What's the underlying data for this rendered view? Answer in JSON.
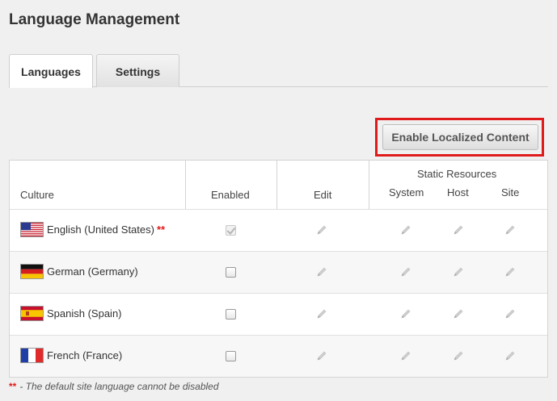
{
  "page": {
    "title": "Language Management"
  },
  "tabs": [
    {
      "label": "Languages",
      "active": true
    },
    {
      "label": "Settings",
      "active": false
    }
  ],
  "actions": {
    "enable_localized_label": "Enable Localized Content",
    "highlight_color": "#e01b1b"
  },
  "grid": {
    "headers": {
      "culture": "Culture",
      "enabled": "Enabled",
      "edit": "Edit",
      "static_group": "Static Resources",
      "system": "System",
      "host": "Host",
      "site": "Site"
    },
    "rows": [
      {
        "culture": "English (United States)",
        "flag": "us-flag-icon",
        "required_marker": "**",
        "enabled": true,
        "enabled_disabled": true
      },
      {
        "culture": "German (Germany)",
        "flag": "de-flag-icon",
        "required_marker": "",
        "enabled": false,
        "enabled_disabled": false
      },
      {
        "culture": "Spanish (Spain)",
        "flag": "es-flag-icon",
        "required_marker": "",
        "enabled": false,
        "enabled_disabled": false
      },
      {
        "culture": "French (France)",
        "flag": "fr-flag-icon",
        "required_marker": "",
        "enabled": false,
        "enabled_disabled": false
      }
    ]
  },
  "footnote": {
    "marker": "**",
    "text": "- The default site language cannot be disabled"
  }
}
